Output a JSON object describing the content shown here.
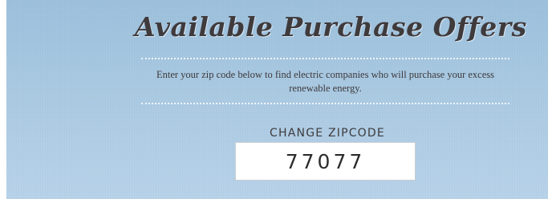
{
  "header": {
    "title": "Available Purchase Offers",
    "description": "Enter your zip code below to find electric companies who will purchase your excess renewable energy."
  },
  "zipcode": {
    "label": "CHANGE ZIPCODE",
    "value": "77077"
  },
  "colors": {
    "background": "#a9c9e2",
    "title_text": "#3f3a3c",
    "divider": "#ffffff",
    "input_background": "#ffffff"
  }
}
